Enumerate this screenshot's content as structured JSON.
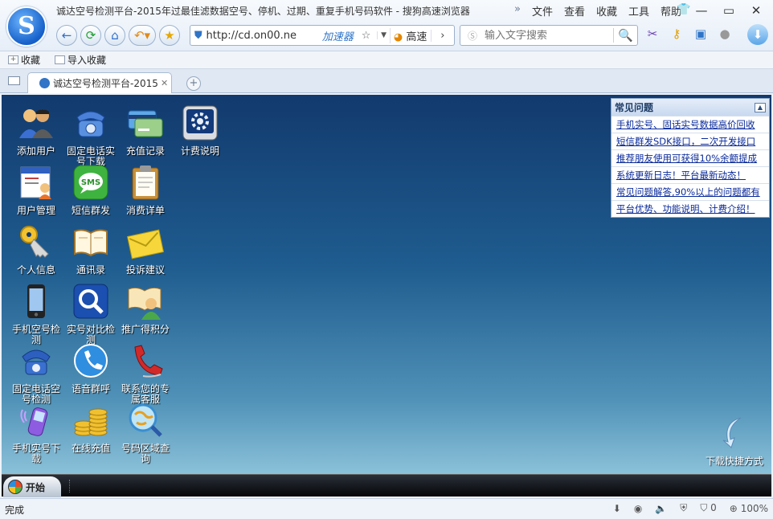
{
  "browser": {
    "window_title": "诚达空号检测平台-2015年过最佳滤数据空号、停机、过期、重复手机号码软件 - 搜狗高速浏览器",
    "menu": [
      "文件",
      "查看",
      "收藏",
      "工具",
      "帮助"
    ],
    "address": {
      "url": "http://cd.on00.ne",
      "accelerator": "加速器",
      "speed_label": "高速"
    },
    "search": {
      "placeholder": "输入文字搜索"
    },
    "favorites_bar": {
      "add": "收藏",
      "import": "导入收藏"
    },
    "tab": {
      "label": "诚达空号检测平台-2015"
    },
    "status": {
      "text": "完成",
      "security_count": "0",
      "zoom": "100%"
    }
  },
  "desktop": {
    "icons": [
      {
        "label": "添加用户",
        "icon": "users-icon"
      },
      {
        "label": "固定电话实号下载",
        "icon": "telephone-icon"
      },
      {
        "label": "充值记录",
        "icon": "credit-card-icon"
      },
      {
        "label": "计费说明",
        "icon": "settings-icon"
      },
      {
        "label": "用户管理",
        "icon": "user-card-icon"
      },
      {
        "label": "短信群发",
        "icon": "sms-icon"
      },
      {
        "label": "消费详单",
        "icon": "clipboard-icon"
      },
      {
        "label": "个人信息",
        "icon": "key-icon"
      },
      {
        "label": "通讯录",
        "icon": "book-icon"
      },
      {
        "label": "投诉建议",
        "icon": "envelope-icon"
      },
      {
        "label": "手机空号检测",
        "icon": "mobile-phone-icon"
      },
      {
        "label": "实号对比检测",
        "icon": "magnifier-icon"
      },
      {
        "label": "推广得积分",
        "icon": "reader-icon"
      },
      {
        "label": "固定电话空号检测",
        "icon": "desk-phone-icon"
      },
      {
        "label": "语音群呼",
        "icon": "voice-call-icon"
      },
      {
        "label": "联系您的专属客服",
        "icon": "handset-icon"
      },
      {
        "label": "手机实号下载",
        "icon": "ringing-phone-icon"
      },
      {
        "label": "在线充值",
        "icon": "coins-icon"
      },
      {
        "label": "号码区域查询",
        "icon": "area-search-icon"
      }
    ],
    "faq": {
      "title": "常见问题",
      "items": [
        "手机实号、固话实号数据高价回收",
        "短信群发SDK接口，二次开发接口",
        "推荐朋友使用可获得10%余额提成",
        "系统更新日志！平台最新动态！",
        "常见问题解答,90%以上的问题都有",
        "平台优势、功能说明、计费介绍！"
      ]
    },
    "shortcut_label": "下载快捷方式",
    "start_label": "开始"
  }
}
